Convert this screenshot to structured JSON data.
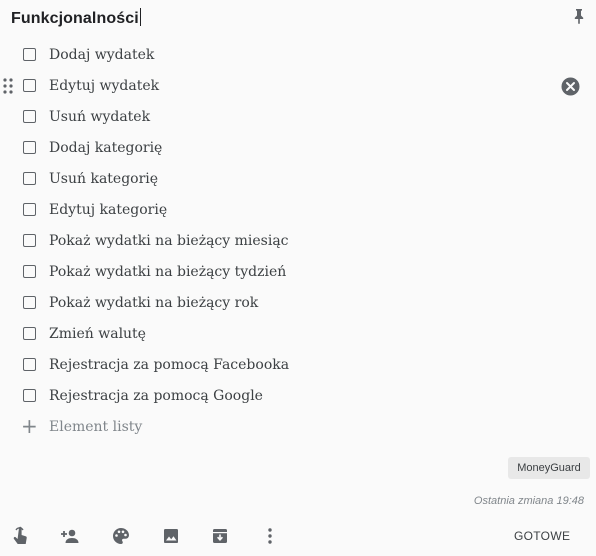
{
  "note": {
    "title": "Funkcjonalności",
    "items": [
      {
        "label": "Dodaj wydatek",
        "checked": false
      },
      {
        "label": "Edytuj wydatek",
        "checked": false
      },
      {
        "label": "Usuń wydatek",
        "checked": false
      },
      {
        "label": "Dodaj kategorię",
        "checked": false
      },
      {
        "label": "Usuń kategorię",
        "checked": false
      },
      {
        "label": "Edytuj kategorię",
        "checked": false
      },
      {
        "label": "Pokaż wydatki na bieżący miesiąc",
        "checked": false
      },
      {
        "label": "Pokaż wydatki na bieżący tydzień",
        "checked": false
      },
      {
        "label": "Pokaż wydatki na bieżący rok",
        "checked": false
      },
      {
        "label": "Zmień walutę",
        "checked": false
      },
      {
        "label": "Rejestracja za pomocą Facebooka",
        "checked": false
      },
      {
        "label": "Rejestracja za pomocą Google",
        "checked": false
      }
    ],
    "add_item_placeholder": "Element listy",
    "label_chip": "MoneyGuard",
    "last_edited": "Ostatnia zmiana 19:48"
  },
  "toolbar": {
    "icons": [
      "remind-me-icon",
      "collaborator-icon",
      "palette-icon",
      "image-icon",
      "archive-icon",
      "more-icon"
    ],
    "done_label": "GOTOWE"
  },
  "colors": {
    "background": "#fafafa",
    "text": "#3c4043",
    "muted": "#80868b",
    "chip": "#e8e8e8"
  }
}
